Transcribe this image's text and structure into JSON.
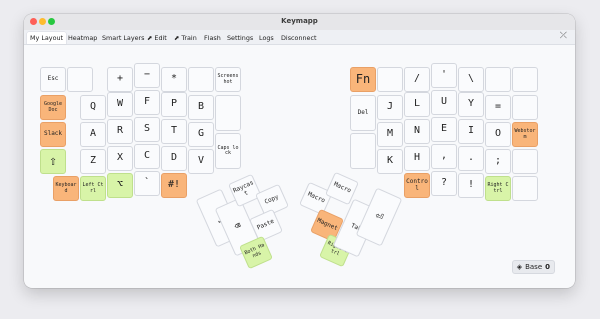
{
  "window": {
    "title": "Keymapp"
  },
  "menu": {
    "tabs": [
      "My Layout",
      "Heatmap",
      "Smart Layers",
      "Edit",
      "Train",
      "Flash",
      "Settings",
      "Logs",
      "Disconnect"
    ],
    "edit_icon": "external-link-icon",
    "train_icon": "external-link-icon",
    "pin_icon": "pin-off-icon"
  },
  "keyboard": {
    "left": {
      "row1": [
        "Esc",
        "",
        "+",
        "−",
        "*",
        "",
        "Screenshot"
      ],
      "row2": [
        "Google Doc",
        "Q",
        "W",
        "F",
        "P",
        "B",
        ""
      ],
      "row3": [
        "Slack",
        "A",
        "R",
        "S",
        "T",
        "G",
        "Caps lock"
      ],
      "row4": [
        "⇧",
        "Z",
        "X",
        "C",
        "D",
        "V",
        ""
      ],
      "row5": [
        "Keyboard",
        "Left Ctrl",
        "⌥",
        "`",
        "#!"
      ],
      "thumb": [
        "⎵",
        "⌫",
        "Raycast",
        "Copy",
        "Paste",
        "Both Hands"
      ]
    },
    "right": {
      "row1": [
        "Fn",
        "",
        "/",
        "'",
        "\\",
        "",
        ""
      ],
      "row2": [
        "Del",
        "J",
        "L",
        "U",
        "Y",
        "=",
        ""
      ],
      "row3": [
        "",
        "M",
        "N",
        "E",
        "I",
        "O",
        "Webstorm"
      ],
      "row4": [
        "",
        "K",
        "H",
        ",",
        ".",
        ";",
        ""
      ],
      "row5": [
        "Control",
        "?",
        "!",
        "Right Ctrl",
        ""
      ],
      "thumb": [
        "Macro",
        "Macro",
        "Magnet",
        "Right Ctrl",
        "Tab",
        "⏎"
      ]
    }
  },
  "layer": {
    "label": "Base",
    "index": "0",
    "icon": "layers-icon"
  },
  "colors": {
    "orange": "#f9b57a",
    "green": "#d8f4a8"
  }
}
